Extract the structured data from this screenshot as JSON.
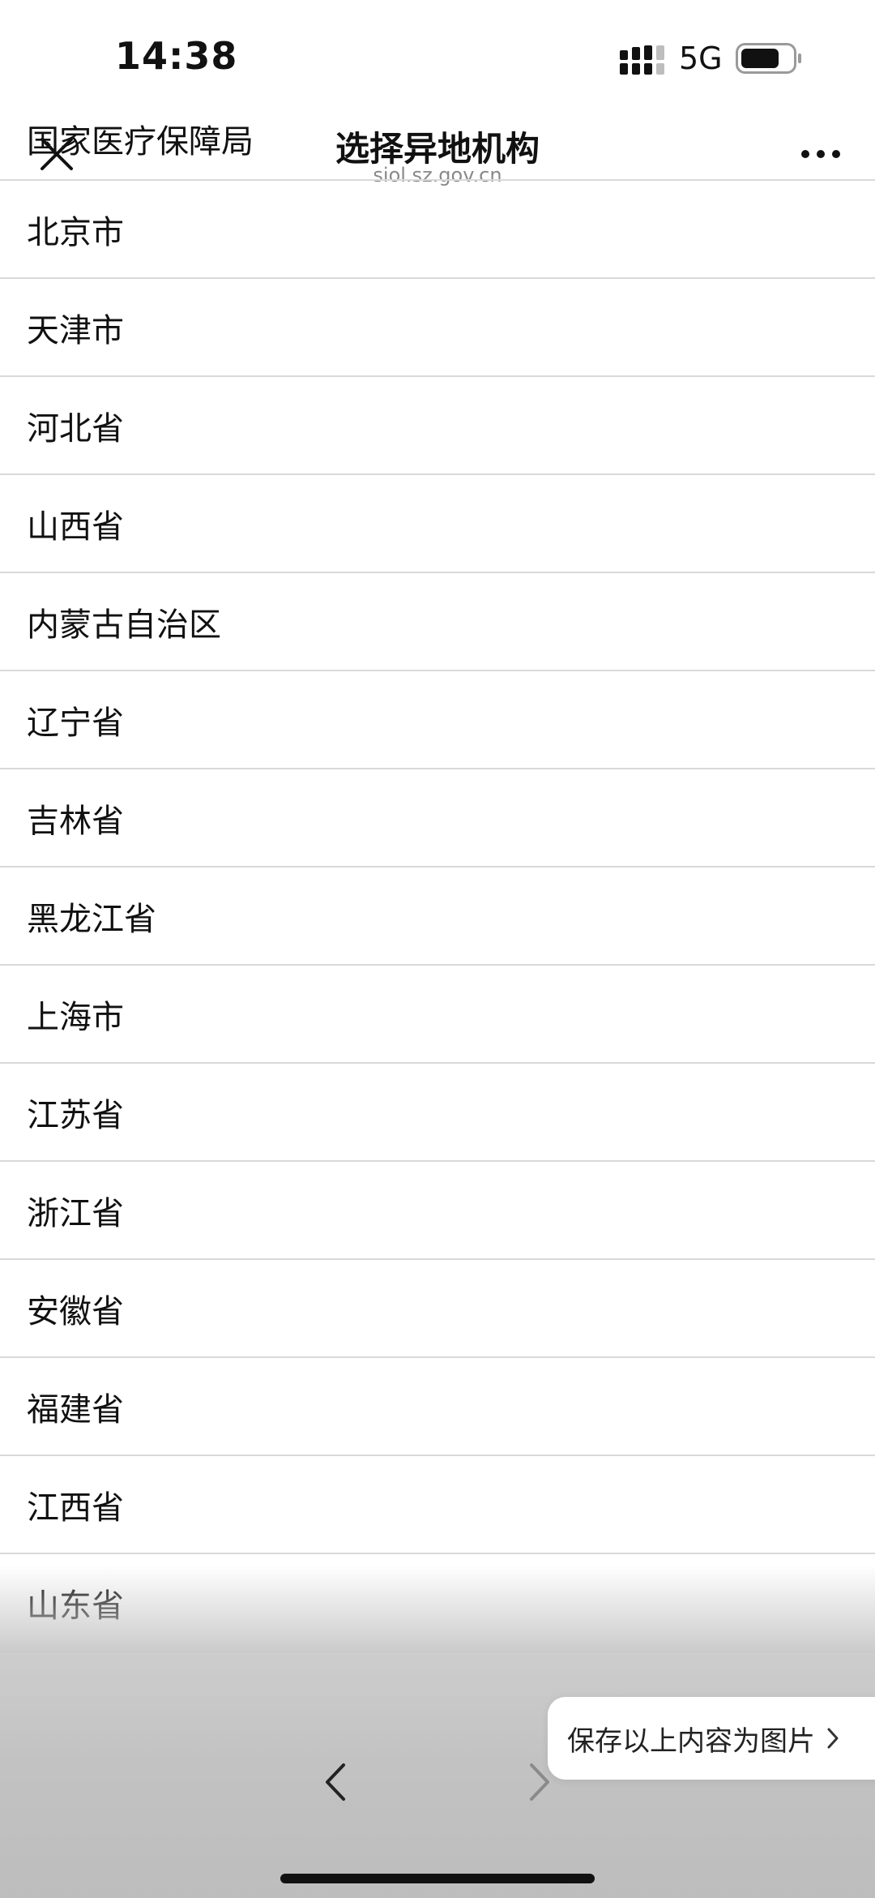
{
  "status": {
    "time": "14:38",
    "network": "5G"
  },
  "nav": {
    "title": "选择异地机构",
    "subtitle": "siol.sz.gov.cn"
  },
  "list": [
    "国家医疗保障局",
    "北京市",
    "天津市",
    "河北省",
    "山西省",
    "内蒙古自治区",
    "辽宁省",
    "吉林省",
    "黑龙江省",
    "上海市",
    "江苏省",
    "浙江省",
    "安徽省",
    "福建省",
    "江西省",
    "山东省"
  ],
  "bottom": {
    "save_label": "保存以上内容为图片"
  }
}
